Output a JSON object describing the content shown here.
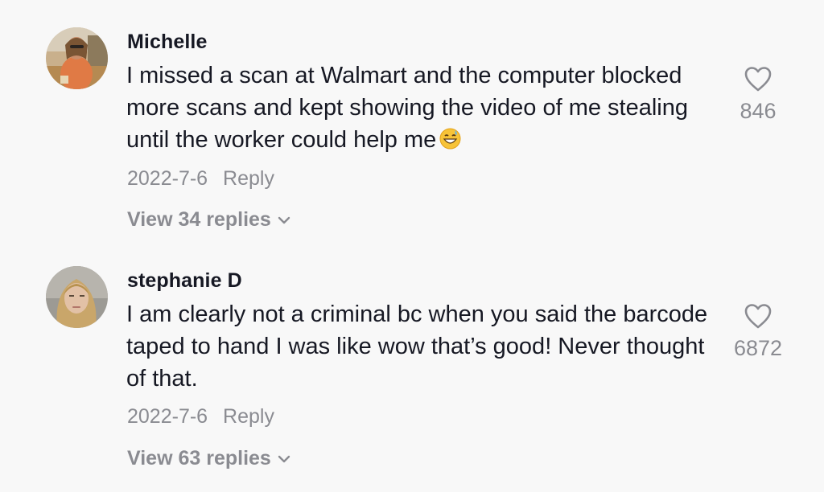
{
  "comments": [
    {
      "username": "Michelle",
      "text": "I missed a scan at Walmart and the computer blocked more scans and kept showing the video of me stealing until the worker could help me",
      "emoji": "grinning-sweat-emoji",
      "date": "2022-7-6",
      "reply_label": "Reply",
      "view_replies": "View 34 replies",
      "likes": "846",
      "avatar": "profile-photo"
    },
    {
      "username": "stephanie D",
      "text": "I am clearly not a criminal bc when you said the barcode taped to hand I was like wow that’s good! Never thought of that.",
      "date": "2022-7-6",
      "reply_label": "Reply",
      "view_replies": "View 63 replies",
      "likes": "6872",
      "avatar": "profile-photo"
    }
  ],
  "colors": {
    "background": "#f8f8f8",
    "primary_text": "#161823",
    "secondary_text": "#8a8b91"
  }
}
